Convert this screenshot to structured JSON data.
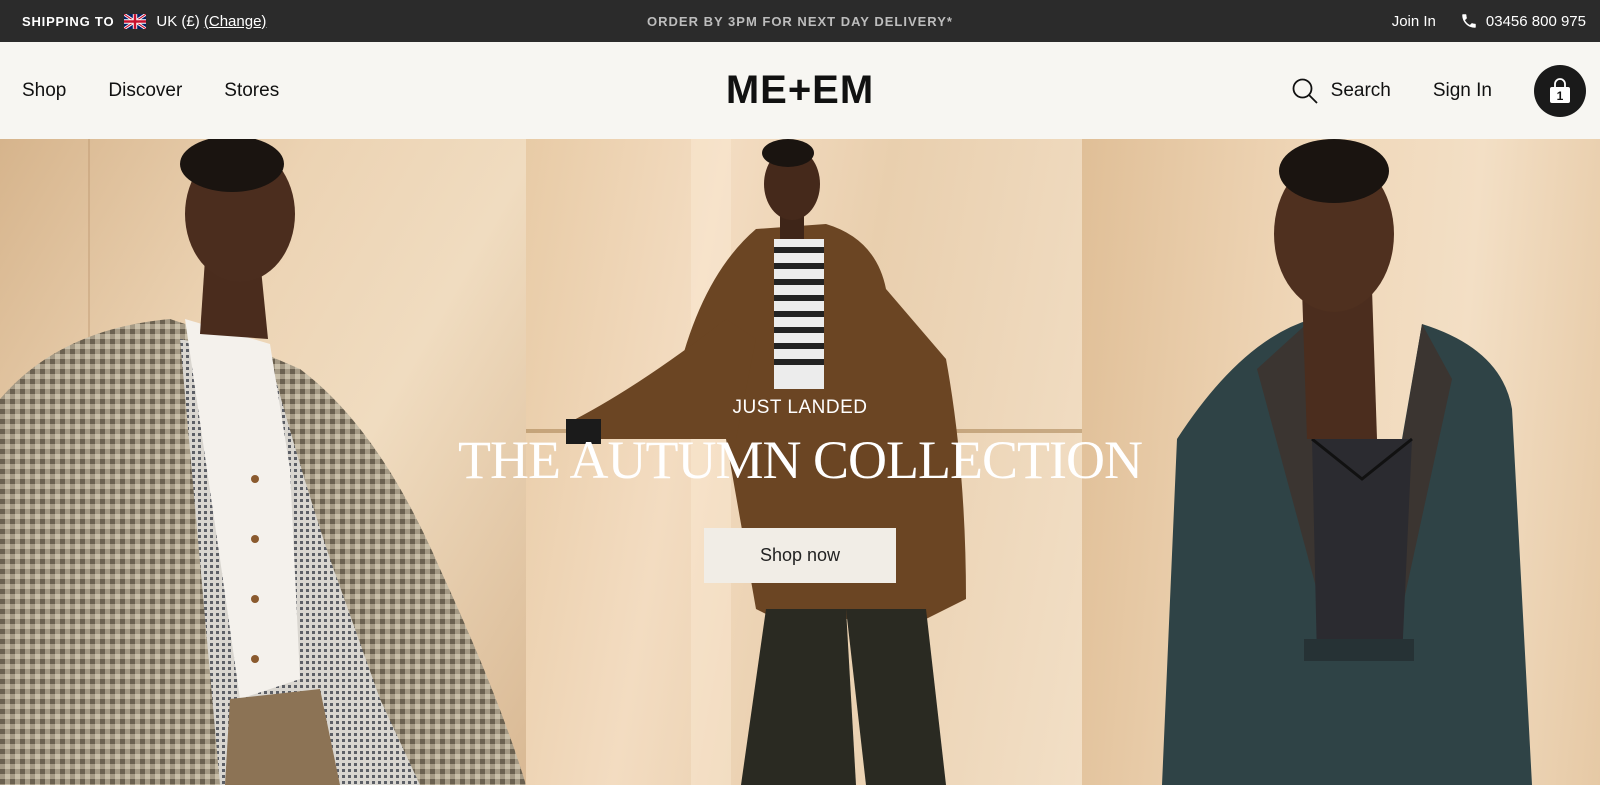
{
  "topbar": {
    "shipping_label": "SHIPPING TO",
    "country": "UK (£)",
    "change_link": "(Change)",
    "promo": "ORDER BY 3PM FOR NEXT DAY DELIVERY*",
    "join_in": "Join In",
    "phone": "03456 800 975"
  },
  "header": {
    "nav": [
      "Shop",
      "Discover",
      "Stores"
    ],
    "logo": "ME+EM",
    "search_label": "Search",
    "sign_in": "Sign In",
    "bag_count": "1"
  },
  "hero": {
    "eyebrow": "JUST LANDED",
    "headline": "THE AUTUMN COLLECTION",
    "cta": "Shop now"
  },
  "colors": {
    "topbar_bg": "#2b2b2b",
    "header_bg": "#f7f6f2",
    "cta_bg": "#f1ede6"
  },
  "icons": [
    "uk-flag-icon",
    "phone-icon",
    "search-icon",
    "shopping-bag-icon"
  ]
}
